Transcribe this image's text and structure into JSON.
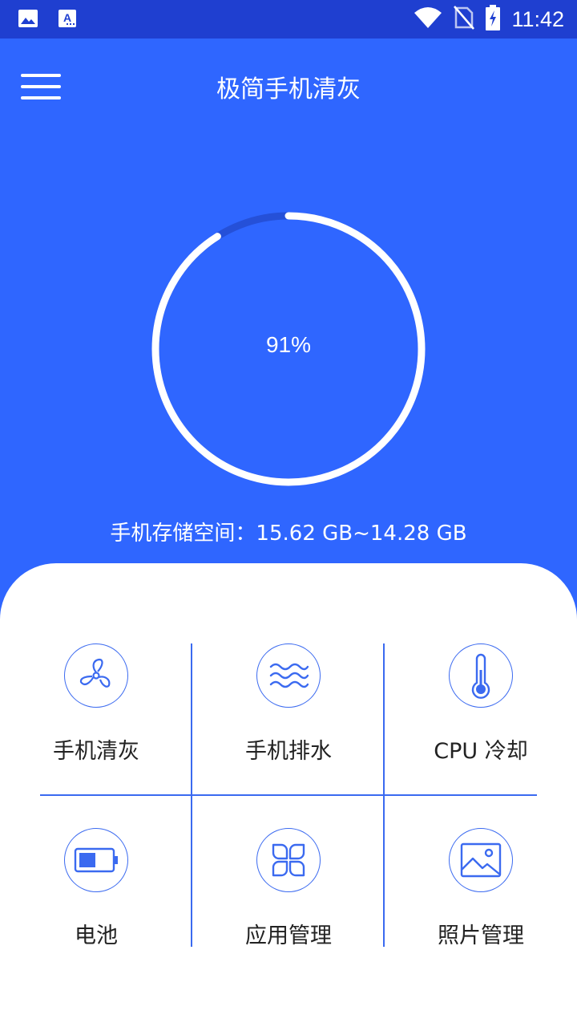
{
  "status_bar": {
    "time": "11:42",
    "left_icons": [
      "image-icon",
      "font-icon"
    ],
    "right_icons": [
      "wifi-icon",
      "no-sim-icon",
      "battery-charging-icon"
    ]
  },
  "header": {
    "title": "极简手机清灰"
  },
  "usage": {
    "percent_label": "91%",
    "percent_value": 91,
    "storage_label": "手机存储空间：15.62 GB~14.28 GB"
  },
  "colors": {
    "primary": "#2f66ff",
    "status_bar": "#1f3fd0",
    "accent_line": "#3b6af0",
    "ring_track": "#2550d8",
    "ring_fill": "#ffffff"
  },
  "features": [
    {
      "label": "手机清灰",
      "icon": "fan-icon"
    },
    {
      "label": "手机排水",
      "icon": "water-waves-icon"
    },
    {
      "label": "CPU 冷却",
      "icon": "thermometer-icon"
    },
    {
      "label": "电池",
      "icon": "battery-icon"
    },
    {
      "label": "应用管理",
      "icon": "app-grid-icon"
    },
    {
      "label": "照片管理",
      "icon": "photo-icon"
    }
  ]
}
